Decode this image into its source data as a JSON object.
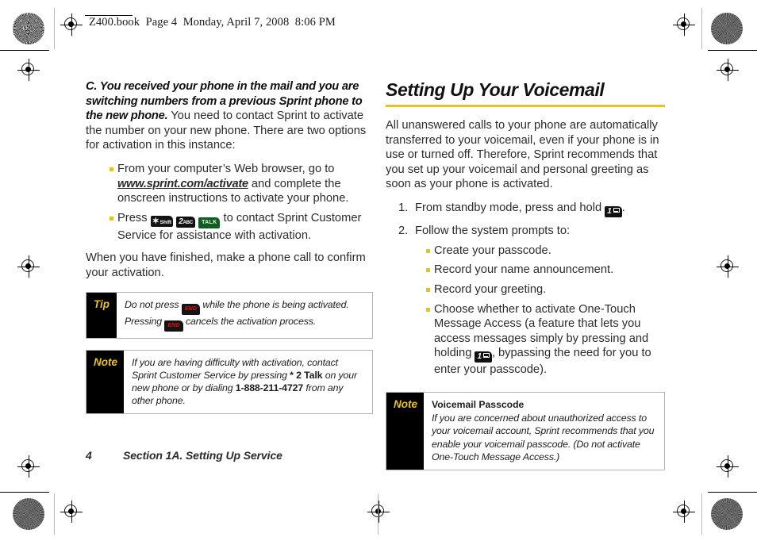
{
  "header": {
    "slug": "Z400.book  Page 4  Monday, April 7, 2008  8:06 PM"
  },
  "left_column": {
    "lead_bold": "C. You received your phone in the mail and you are switching numbers from a previous Sprint phone to the new phone.",
    "lead_rest": " You need to contact Sprint to activate the number on your new phone. There are two options for activation in this instance:",
    "bullets": [
      {
        "pre": "From your computer’s Web browser, go to ",
        "link": "www.sprint.com/activate",
        "post": " and complete the onscreen instructions to activate your phone."
      },
      {
        "pre": "Press ",
        "keys": [
          "shift",
          "two-abc",
          "talk"
        ],
        "post": " to contact Sprint Customer Service for assistance with activation."
      }
    ],
    "closing": "When you have finished, make a phone call to confirm your activation.",
    "tip_box": {
      "label": "Tip",
      "text_a": "Do not press ",
      "text_b": " while the phone is being activated. Pressing ",
      "text_c": " cancels the activation process."
    },
    "note_box": {
      "label": "Note",
      "text_a": "If you are having difficulty with activation, contact Sprint Customer Service by pressing ",
      "bold_a": "* 2 Talk",
      "text_b": " on your new phone or by dialing ",
      "bold_b": "1-888-211-4727",
      "text_c": " from any other phone."
    }
  },
  "right_column": {
    "heading": "Setting Up Your Voicemail",
    "intro": "All unanswered calls to your phone are automatically transferred to your voicemail, even if your phone is in use or turned off. Therefore, Sprint recommends that you set up your voicemail and personal greeting as soon as your phone is activated.",
    "steps": [
      {
        "pre": "From standby mode, press and hold ",
        "key": "one-voicemail",
        "post": "."
      },
      {
        "pre": "Follow the system prompts to:",
        "key": null,
        "post": ""
      }
    ],
    "substeps": [
      {
        "text": "Create your passcode."
      },
      {
        "text": "Record your name announcement."
      },
      {
        "text": "Record your greeting."
      },
      {
        "pre": "Choose whether to activate One-Touch Message Access (a feature that lets you access messages simply by pressing and holding ",
        "key": "one-voicemail",
        "post": ", bypassing the need for you to enter your passcode)."
      }
    ],
    "note_box": {
      "label": "Note",
      "title": "Voicemail Passcode",
      "text": "If you are concerned about unauthorized access to your voicemail account, Sprint recommends that you enable your voicemail passcode. (Do not activate One-Touch Message Access.)"
    }
  },
  "footer": {
    "page_number": "4",
    "section": "Section 1A. Setting Up Service"
  },
  "keys": {
    "shift": {
      "star": "✶",
      "label": "Shift"
    },
    "two-abc": {
      "num": "2",
      "label": "ABC"
    },
    "talk": {
      "label": "TALK"
    },
    "end": {
      "label": "END"
    },
    "one-voicemail": {
      "num": "1",
      "label": "envelope"
    }
  },
  "colors": {
    "accent_yellow": "#e8c41a",
    "talk_green": "#0f5c22",
    "end_red": "#d21414",
    "body_text": "#2b2b2b"
  }
}
